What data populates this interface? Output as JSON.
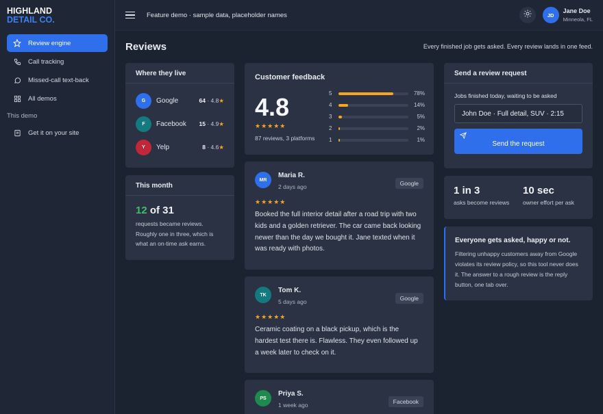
{
  "brand": {
    "line1": "HIGHLAND",
    "line2": "DETAIL CO."
  },
  "sidebar": {
    "items": [
      {
        "label": "Review engine",
        "icon": "star-icon",
        "active": true
      },
      {
        "label": "Call tracking",
        "icon": "phone-icon",
        "active": false
      },
      {
        "label": "Missed-call text-back",
        "icon": "chat-icon",
        "active": false
      },
      {
        "label": "All demos",
        "icon": "grid-icon",
        "active": false
      }
    ],
    "section_label": "This demo",
    "section_items": [
      {
        "label": "Get it on your site",
        "icon": "document-icon"
      }
    ]
  },
  "topbar": {
    "demo_text": "Feature demo · sample data, placeholder names",
    "user": {
      "initials": "JD",
      "name": "Jane Doe",
      "location": "Minneola, FL"
    }
  },
  "page": {
    "title": "Reviews",
    "subtitle": "Every finished job gets asked. Every review lands in one feed."
  },
  "platforms": {
    "title": "Where they live",
    "items": [
      {
        "initial": "G",
        "name": "Google",
        "count": "64",
        "rating": "4.8",
        "color": "#2f6fec"
      },
      {
        "initial": "F",
        "name": "Facebook",
        "count": "15",
        "rating": "4.9",
        "color": "#137a80"
      },
      {
        "initial": "Y",
        "name": "Yelp",
        "count": "8",
        "rating": "4.6",
        "color": "#c0283a"
      }
    ]
  },
  "month": {
    "title": "This month",
    "converted": "12",
    "of_total": "of 31",
    "description": "requests became reviews. Roughly one in three, which is what an on-time ask earns."
  },
  "feedback": {
    "title": "Customer feedback",
    "average": "4.8",
    "stars": "★★★★★",
    "summary": "87 reviews, 3 platforms",
    "distribution": [
      {
        "stars": "5",
        "percent": 78,
        "label": "78%"
      },
      {
        "stars": "4",
        "percent": 14,
        "label": "14%"
      },
      {
        "stars": "3",
        "percent": 5,
        "label": "5%"
      },
      {
        "stars": "2",
        "percent": 2,
        "label": "2%"
      },
      {
        "stars": "1",
        "percent": 1,
        "label": "1%"
      }
    ]
  },
  "reviews": [
    {
      "initials": "MR",
      "name": "Maria R.",
      "time": "2 days ago",
      "platform": "Google",
      "stars": "★★★★★",
      "color": "#2f6fec",
      "text": "Booked the full interior detail after a road trip with two kids and a golden retriever. The car came back looking newer than the day we bought it. Jane texted when it was ready with photos."
    },
    {
      "initials": "TK",
      "name": "Tom K.",
      "time": "5 days ago",
      "platform": "Google",
      "stars": "★★★★★",
      "color": "#137a80",
      "text": "Ceramic coating on a black pickup, which is the hardest test there is. Flawless. They even followed up a week later to check on it."
    },
    {
      "initials": "PS",
      "name": "Priya S.",
      "time": "1 week ago",
      "platform": "Facebook",
      "stars": "★★★★★",
      "color": "#1e8a4e",
      "text": ""
    }
  ],
  "request": {
    "title": "Send a review request",
    "field_label": "Jobs finished today, waiting to be asked",
    "field_value": "John Doe · Full detail, SUV · 2:15",
    "button_label": "Send the request"
  },
  "stats": [
    {
      "value": "1 in 3",
      "label": "asks become reviews"
    },
    {
      "value": "10 sec",
      "label": "owner effort per ask"
    }
  ],
  "policy": {
    "title": "Everyone gets asked, happy or not.",
    "text": "Filtering unhappy customers away from Google violates its review policy, so this tool never does it. The answer to a rough review is the reply button, one tab over."
  },
  "colors": {
    "accent": "#2f6fec",
    "star": "#f5a623",
    "success": "#3fbf6a"
  }
}
